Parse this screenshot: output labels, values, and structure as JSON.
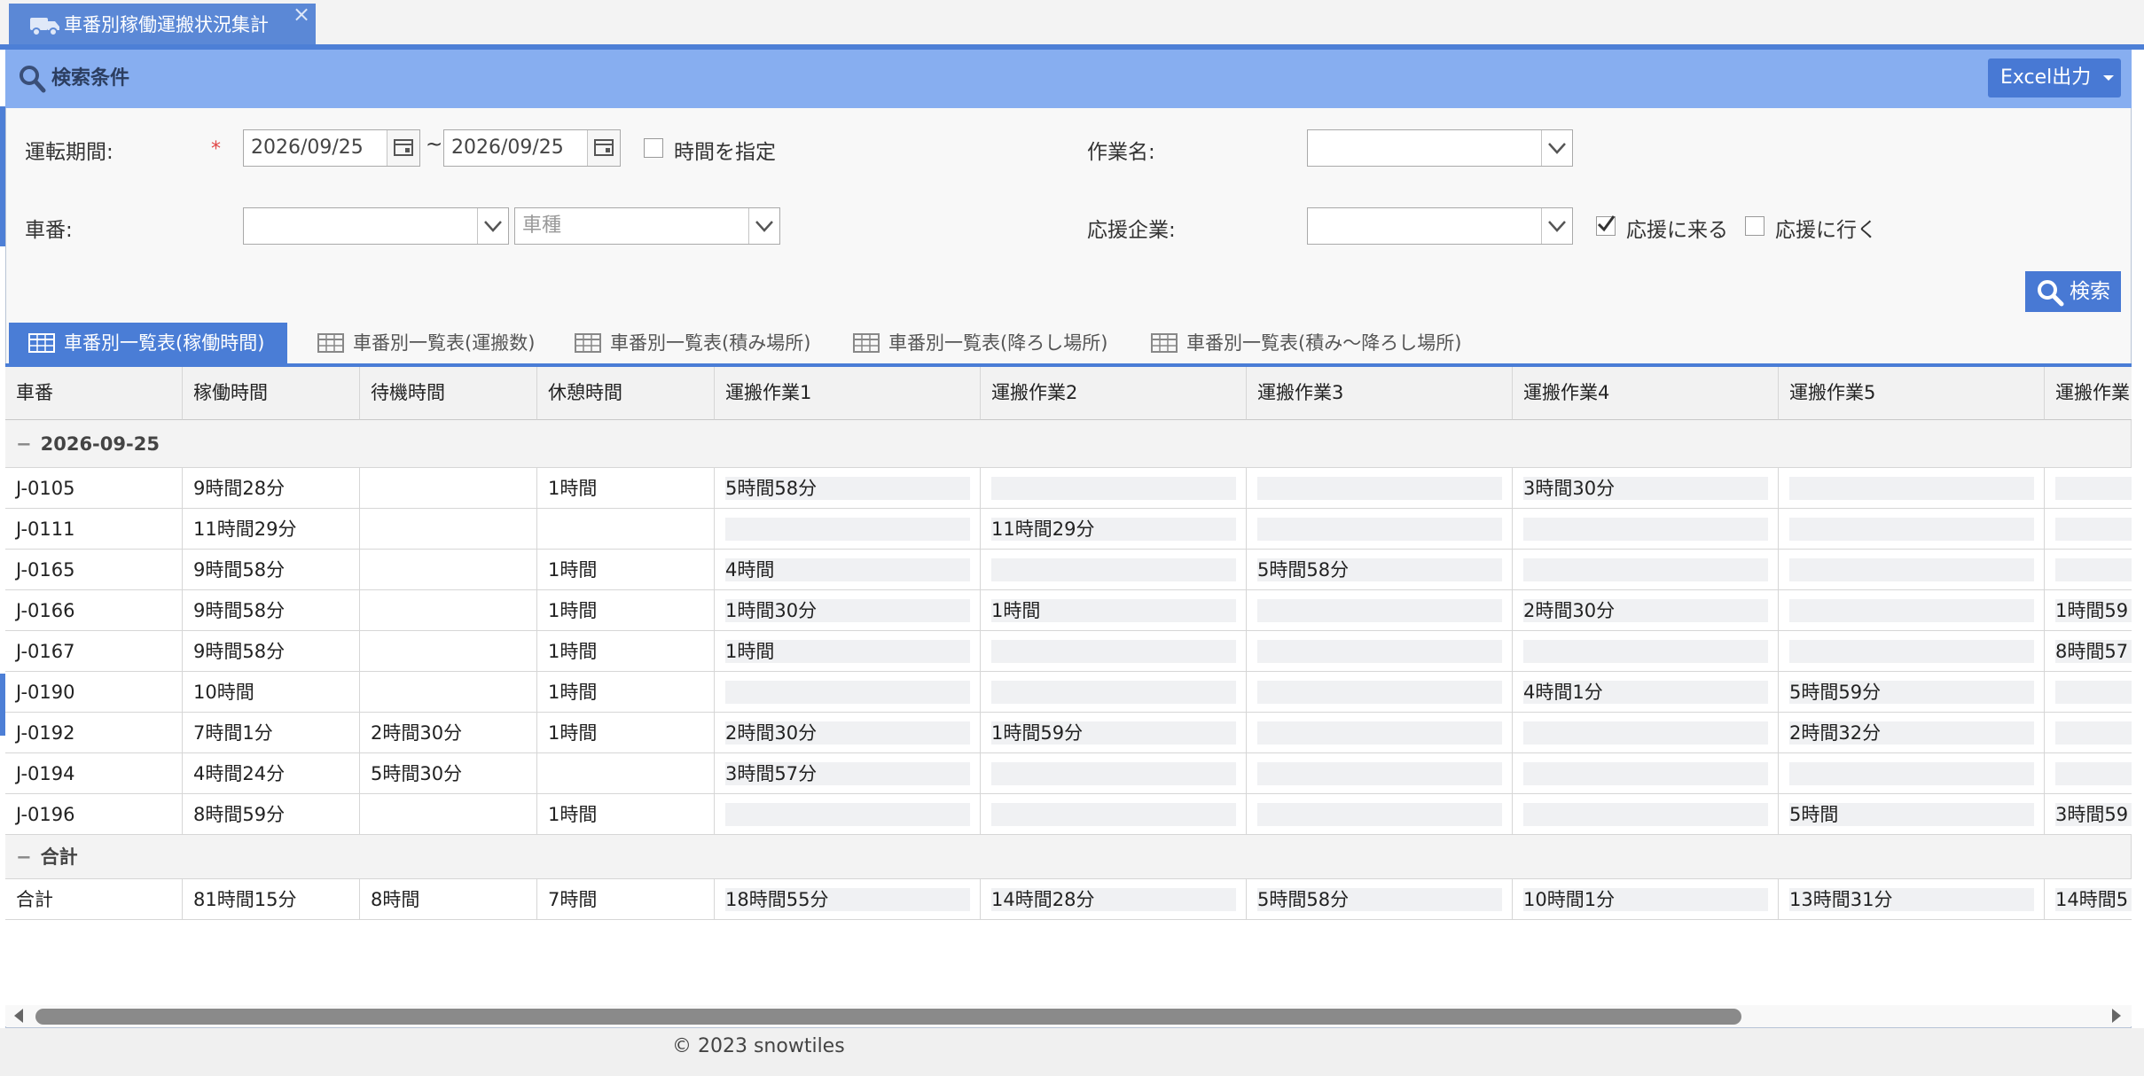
{
  "colors": {
    "accent": "#4879d4",
    "header": "#87aef0"
  },
  "doc_tab": {
    "title": "車番別稼働運搬状況集計",
    "close": "×",
    "icon": "truck-icon"
  },
  "search": {
    "title": "検索条件",
    "excel_button": "Excel出力",
    "period_label": "運転期間:",
    "required_mark": "*",
    "date_from": "2026/09/25",
    "tilde": "~",
    "date_to": "2026/09/25",
    "specify_time": "時間を指定",
    "work_name_label": "作業名:",
    "work_name_value": "",
    "car_no_label": "車番:",
    "car_no_value": "",
    "car_type_placeholder": "車種",
    "support_company_label": "応援企業:",
    "support_company_value": "",
    "come_to_support": "応援に来る",
    "come_to_support_checked": true,
    "go_to_support": "応援に行く",
    "go_to_support_checked": false,
    "search_button": "検索"
  },
  "view_tabs": [
    {
      "label": "車番別一覧表(稼働時間)",
      "active": true
    },
    {
      "label": "車番別一覧表(運搬数)",
      "active": false
    },
    {
      "label": "車番別一覧表(積み場所)",
      "active": false
    },
    {
      "label": "車番別一覧表(降ろし場所)",
      "active": false
    },
    {
      "label": "車番別一覧表(積み〜降ろし場所)",
      "active": false
    }
  ],
  "grid": {
    "columns": [
      "車番",
      "稼働時間",
      "待機時間",
      "休憩時間",
      "運搬作業1",
      "運搬作業2",
      "運搬作業3",
      "運搬作業4",
      "運搬作業5",
      "運搬作業"
    ],
    "group_label": "2026-09-25",
    "group_toggle": "−",
    "rows": [
      [
        "J-0105",
        "9時間28分",
        "",
        "1時間",
        "5時間58分",
        "",
        "",
        "3時間30分",
        "",
        ""
      ],
      [
        "J-0111",
        "11時間29分",
        "",
        "",
        "",
        "11時間29分",
        "",
        "",
        "",
        ""
      ],
      [
        "J-0165",
        "9時間58分",
        "",
        "1時間",
        "4時間",
        "",
        "5時間58分",
        "",
        "",
        ""
      ],
      [
        "J-0166",
        "9時間58分",
        "",
        "1時間",
        "1時間30分",
        "1時間",
        "",
        "2時間30分",
        "",
        "1時間59"
      ],
      [
        "J-0167",
        "9時間58分",
        "",
        "1時間",
        "1時間",
        "",
        "",
        "",
        "",
        "8時間57"
      ],
      [
        "J-0190",
        "10時間",
        "",
        "1時間",
        "",
        "",
        "",
        "4時間1分",
        "5時間59分",
        ""
      ],
      [
        "J-0192",
        "7時間1分",
        "2時間30分",
        "1時間",
        "2時間30分",
        "1時間59分",
        "",
        "",
        "2時間32分",
        ""
      ],
      [
        "J-0194",
        "4時間24分",
        "5時間30分",
        "",
        "3時間57分",
        "",
        "",
        "",
        "",
        ""
      ],
      [
        "J-0196",
        "8時間59分",
        "",
        "1時間",
        "",
        "",
        "",
        "",
        "5時間",
        "3時間59"
      ]
    ],
    "total_group_label": "合計",
    "total_row": [
      "合計",
      "81時間15分",
      "8時間",
      "7時間",
      "18時間55分",
      "14時間28分",
      "5時間58分",
      "10時間1分",
      "13時間31分",
      "14時間5"
    ]
  },
  "footer": {
    "copyright": "© 2023 snowtiles"
  }
}
